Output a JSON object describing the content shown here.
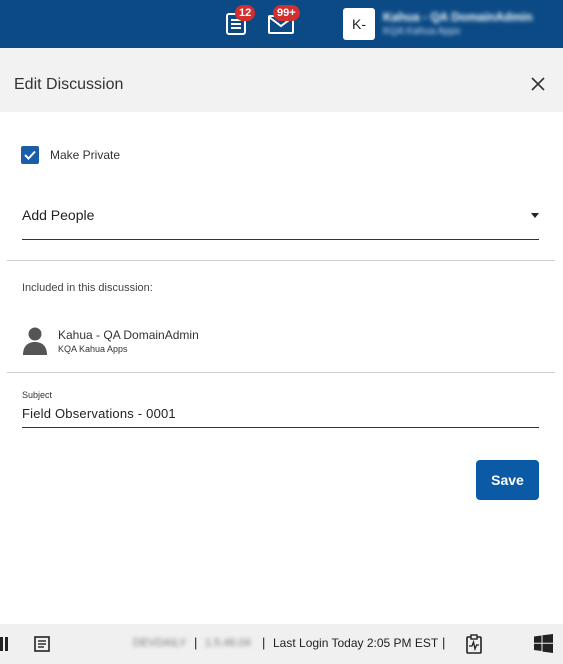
{
  "topbar": {
    "tasks_badge": "12",
    "mail_badge": "99+",
    "avatar_initials": "K-",
    "user_name": "Kahua - QA DomainAdmin",
    "user_org": "KQA Kahua Apps",
    "icons": [
      "tasks-icon",
      "mail-icon"
    ]
  },
  "dialog": {
    "title": "Edit Discussion",
    "make_private_label": "Make Private",
    "make_private_checked": true,
    "add_people_label": "Add People",
    "included_label": "Included in this discussion:",
    "participants": [
      {
        "name": "Kahua - QA DomainAdmin",
        "org": "KQA Kahua Apps"
      }
    ],
    "subject_label": "Subject",
    "subject_value": "Field Observations - 0001",
    "save_label": "Save"
  },
  "taskbar": {
    "env": "DEVDAILY",
    "version": "1.5.46.04",
    "last_login": "Last Login Today 2:05 PM EST",
    "separator": "|"
  },
  "colors": {
    "topbar": "#0b4a85",
    "badge": "#d32f2f",
    "primary": "#0b5aa6",
    "checkbox": "#1a5ea8"
  }
}
